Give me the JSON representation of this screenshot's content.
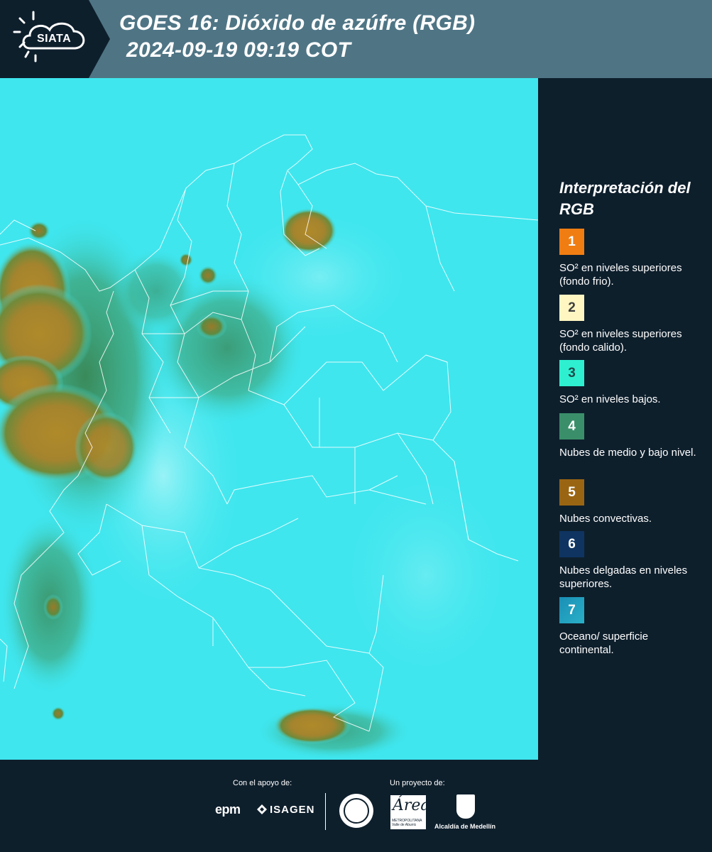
{
  "header": {
    "logo_text": "SIATA",
    "title_line1": "GOES 16: Dióxido de azúfre (RGB)",
    "title_line2": "2024-09-19 09:19 COT",
    "background_color": "#4f7585"
  },
  "map": {
    "description_icon": "satellite-rgb-map",
    "base_color": "#3fe6ee"
  },
  "legend": {
    "title": "Interpretación del RGB",
    "items": [
      {
        "number": "1",
        "label": "SO² en niveles superiores (fondo frio).",
        "color": "#f07d12",
        "text_color": "#ffffff"
      },
      {
        "number": "2",
        "label": "SO² en niveles superiores (fondo calido).",
        "color": "#fff6c2",
        "text_color": "#3d3d3d"
      },
      {
        "number": "3",
        "label": "SO² en niveles bajos.",
        "color": "#2ef0d0",
        "text_color": "#1f4a4a"
      },
      {
        "number": "4",
        "label": "Nubes de medio y bajo nivel.",
        "color": "#3a8f6a",
        "text_color": "#ffffff"
      },
      {
        "number": "5",
        "label": "Nubes convectivas.",
        "color": "#9a6512",
        "text_color": "#ffffff"
      },
      {
        "number": "6",
        "label": "Nubes delgadas en niveles superiores.",
        "color": "#0f3461",
        "text_color": "#ffffff"
      },
      {
        "number": "7",
        "label": "Oceano/ superficie continental.",
        "color": "#1a8fb5",
        "text_color": "#ffffff"
      }
    ]
  },
  "footer": {
    "support_label": "Con el apoyo de:",
    "project_label": "Un proyecto de:",
    "epm": "epm",
    "isagen": "ISAGEN",
    "area_script": "Área",
    "area_sub": "METROPOLITANA Valle de Aburrá",
    "alcaldia": "Alcaldía de Medellín"
  }
}
